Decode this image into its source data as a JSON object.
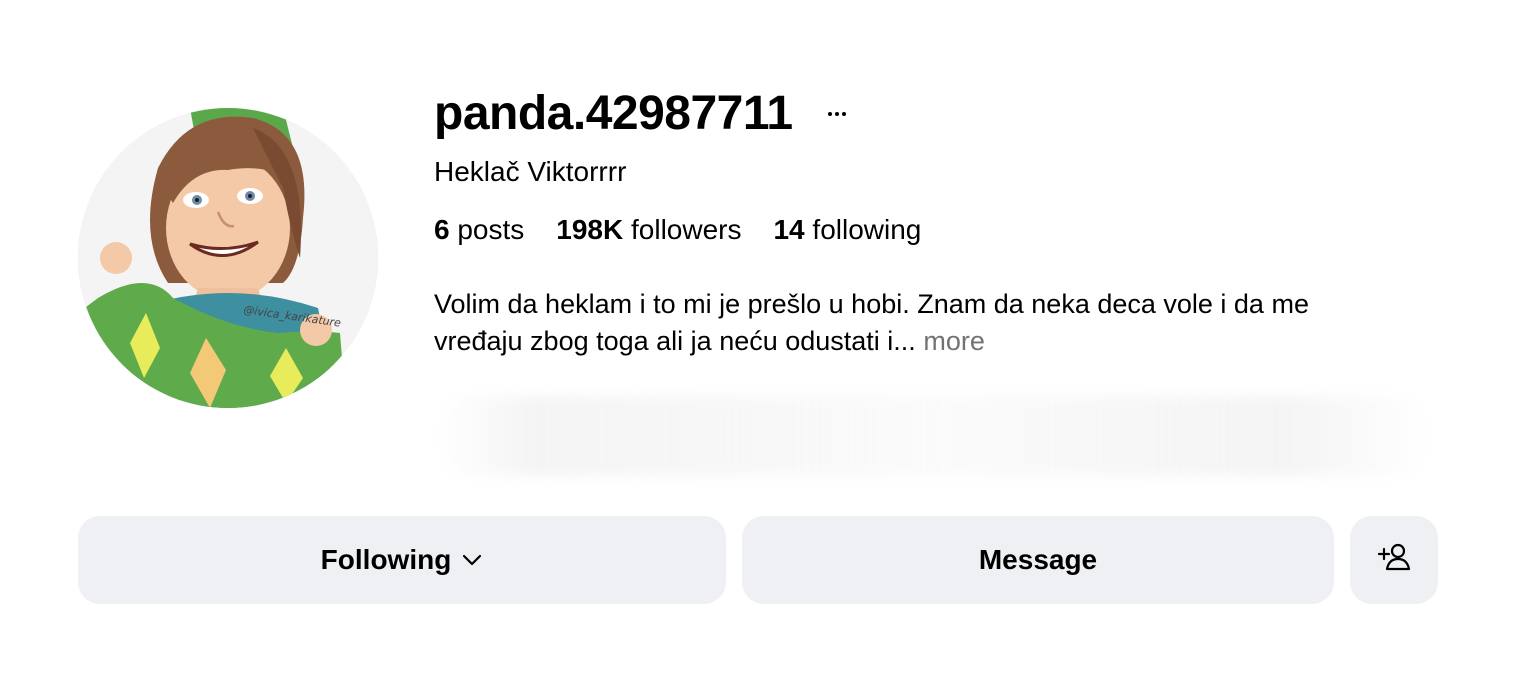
{
  "profile": {
    "username": "panda.42987711",
    "full_name": "Heklač Viktorrrr",
    "avatar_icon": "profile-avatar-cartoon",
    "stats": {
      "posts_count": "6",
      "posts_label": " posts",
      "followers_count": "198K",
      "followers_label": " followers",
      "following_count": "14",
      "following_label": " following"
    },
    "bio": {
      "text": "Volim da heklam i to mi je prešlo u hobi. Znam da neka deca vole i da me vređaju zbog toga ali ja neću odustati i...",
      "more_label": "more"
    }
  },
  "actions": {
    "following_label": "Following",
    "message_label": "Message",
    "add_user_icon": "add-user-icon"
  },
  "colors": {
    "button_bg": "#eff0f4",
    "muted_text": "#737373",
    "avatar_green": "#5ba84a",
    "avatar_hair": "#8a5a3c"
  }
}
